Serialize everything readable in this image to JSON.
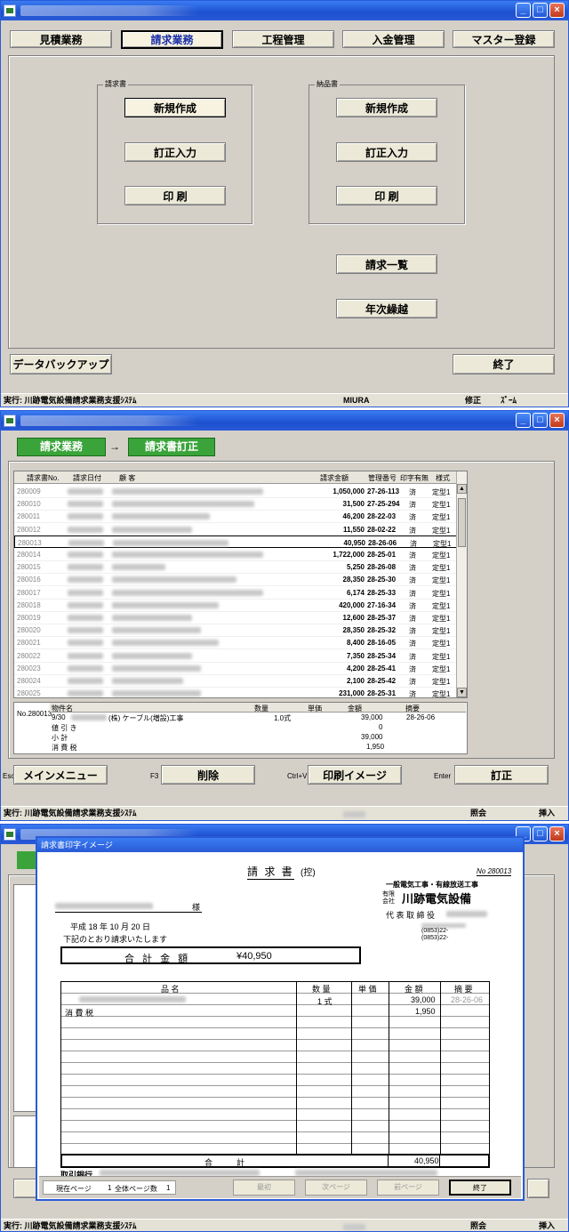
{
  "menu_window": {
    "tabs": [
      "見積業務",
      "請求業務",
      "工程管理",
      "入金管理",
      "マスター登録"
    ],
    "selected_tab": "請求業務",
    "invoice_group": {
      "label": "請求書",
      "buttons": [
        "新規作成",
        "訂正入力",
        "印 刷"
      ]
    },
    "delivery_group": {
      "label": "納品書",
      "buttons": [
        "新規作成",
        "訂正入力",
        "印 刷"
      ]
    },
    "extra_buttons": [
      "請求一覧",
      "年次繰越"
    ],
    "backup_button": "データバックアップ",
    "exit_button": "終了",
    "status": {
      "left": "実行: 川跡電気設備請求業務支援ｼｽﾃﾑ",
      "user": "MIURA",
      "mode": "修正",
      "zoom": "ｽﾞｰﾑ"
    }
  },
  "list_window": {
    "breadcrumb": {
      "from": "請求業務",
      "arrow": "→",
      "to": "請求書訂正"
    },
    "columns": [
      "請求書No.",
      "請求日付",
      "顧 客",
      "請求金額",
      "管理番号",
      "印字有無",
      "様式"
    ],
    "rows": [
      {
        "no": "280009",
        "amount": "1,050,000",
        "mgmt": "27-26-113",
        "printed": "済",
        "form": "定型1"
      },
      {
        "no": "280010",
        "amount": "31,500",
        "mgmt": "27-25-294",
        "printed": "済",
        "form": "定型1"
      },
      {
        "no": "280011",
        "amount": "46,200",
        "mgmt": "28-22-03",
        "printed": "済",
        "form": "定型1"
      },
      {
        "no": "280012",
        "amount": "11,550",
        "mgmt": "28-02-22",
        "printed": "済",
        "form": "定型1"
      },
      {
        "no": "280013",
        "amount": "40,950",
        "mgmt": "28-26-06",
        "printed": "済",
        "form": "定型1"
      },
      {
        "no": "280014",
        "amount": "1,722,000",
        "mgmt": "28-25-01",
        "printed": "済",
        "form": "定型1"
      },
      {
        "no": "280015",
        "amount": "5,250",
        "mgmt": "28-26-08",
        "printed": "済",
        "form": "定型1"
      },
      {
        "no": "280016",
        "amount": "28,350",
        "mgmt": "28-25-30",
        "printed": "済",
        "form": "定型1"
      },
      {
        "no": "280017",
        "amount": "6,174",
        "mgmt": "28-25-33",
        "printed": "済",
        "form": "定型1"
      },
      {
        "no": "280018",
        "amount": "420,000",
        "mgmt": "27-16-34",
        "printed": "済",
        "form": "定型1"
      },
      {
        "no": "280019",
        "amount": "12,600",
        "mgmt": "28-25-37",
        "printed": "済",
        "form": "定型1"
      },
      {
        "no": "280020",
        "amount": "28,350",
        "mgmt": "28-25-32",
        "printed": "済",
        "form": "定型1"
      },
      {
        "no": "280021",
        "amount": "8,400",
        "mgmt": "28-16-05",
        "printed": "済",
        "form": "定型1"
      },
      {
        "no": "280022",
        "amount": "7,350",
        "mgmt": "28-25-34",
        "printed": "済",
        "form": "定型1"
      },
      {
        "no": "280023",
        "amount": "4,200",
        "mgmt": "28-25-41",
        "printed": "済",
        "form": "定型1"
      },
      {
        "no": "280024",
        "amount": "2,100",
        "mgmt": "28-25-42",
        "printed": "済",
        "form": "定型1"
      },
      {
        "no": "280025",
        "amount": "231,000",
        "mgmt": "28-25-31",
        "printed": "済",
        "form": "定型1"
      }
    ],
    "detail": {
      "no_label": "No.280013",
      "headers": [
        "物件名",
        "数量",
        "単価",
        "金額",
        "摘要"
      ],
      "item_date": "9/30",
      "item_name": "(株) ケーブル(増設)工事",
      "qty": "1.0式",
      "amount": "39,000",
      "memo": "28-26-06",
      "discount_label": "値 引 き",
      "discount": "0",
      "subtotal_label": "小 計",
      "subtotal": "39,000",
      "tax_label": "消 費 税",
      "tax": "1,950"
    },
    "fkeys": {
      "esc": "Esc",
      "menu": "メインメニュー",
      "f3": "F3",
      "delete": "削除",
      "ctrlv": "Ctrl+V",
      "print_image": "印刷イメージ",
      "enter": "Enter",
      "correct": "訂正"
    },
    "status": {
      "left": "実行: 川跡電気設備請求業務支援ｼｽﾃﾑ",
      "mode": "照会",
      "ins": "挿入"
    }
  },
  "preview_window": {
    "dialog_title": "請求書印字イメージ",
    "doc_title": "請 求 書",
    "doc_title_suffix": "(控)",
    "doc_no": "No 280013",
    "company_type": "一般電気工事・有線放送工事",
    "company_prefix": "有限会社",
    "company_name": "川跡電気設備",
    "rep_title": "代 表 取 締 役",
    "customer_suffix": "様",
    "date_line": "平成 18 年  10 月  20 日",
    "request_line": "下記のとおり請求いたします",
    "total_label": "合 計 金 額",
    "total_value": "¥40,950",
    "table_headers": [
      "品 名",
      "数 量",
      "単 価",
      "金 額",
      "摘 要"
    ],
    "line1_qty": "1  式",
    "line1_amount": "39,000",
    "line1_memo": "28-26-06",
    "tax_label": "消 費 税",
    "tax_amount": "1,950",
    "sum_label": "合　　　計",
    "sum_amount": "40,950",
    "bank_label": "取引銀行",
    "tel1": "(0853)22-",
    "tel2": "(0853)22-",
    "nav": {
      "current_label": "現在ページ",
      "current": "1",
      "total_label": "全体ページ数",
      "total": "1",
      "first": "最初",
      "next": "次ページ",
      "prev": "前ページ",
      "exit": "終了"
    },
    "status": {
      "left": "実行: 川跡電気設備請求業務支援ｼｽﾃﾑ",
      "mode": "照会",
      "ins": "挿入"
    }
  }
}
